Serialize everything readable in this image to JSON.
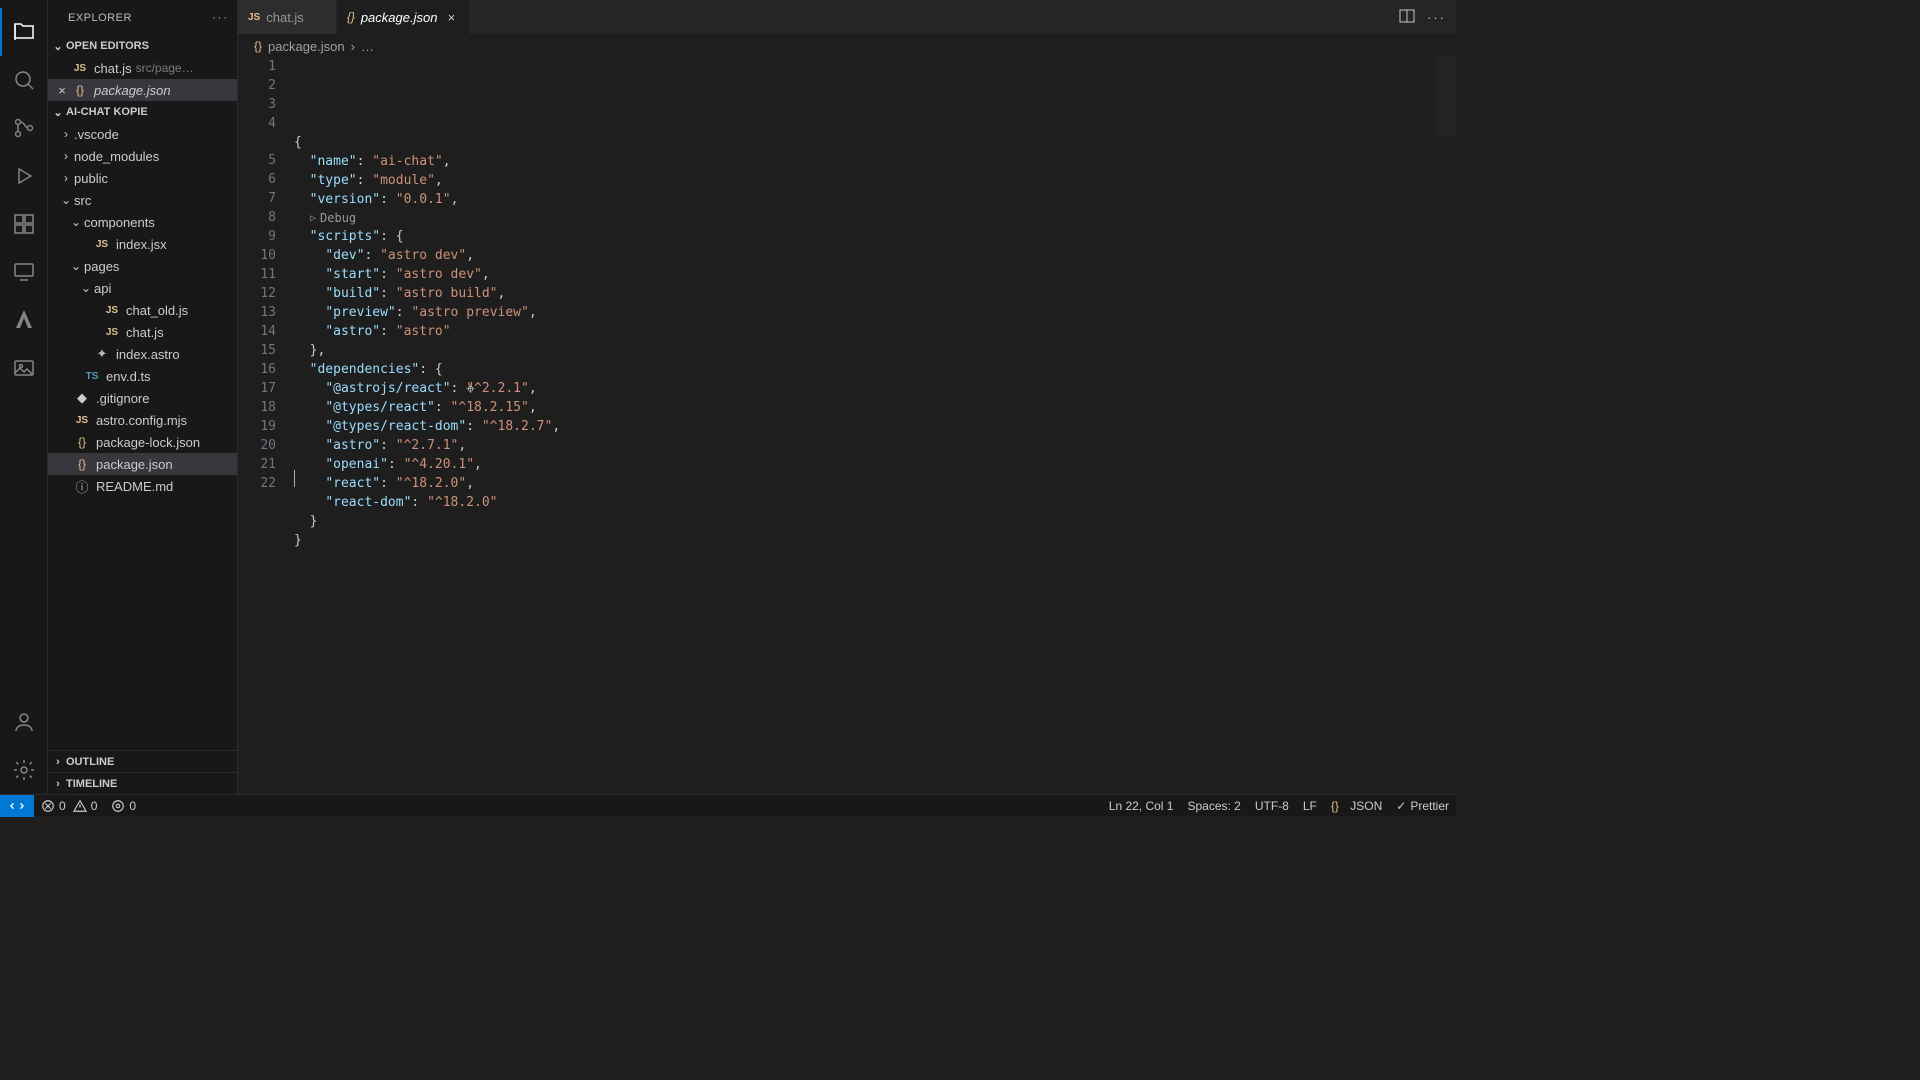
{
  "explorer_title": "EXPLORER",
  "open_editors_label": "OPEN EDITORS",
  "open_editors": [
    {
      "name": "chat.js",
      "hint": "src/page…",
      "icon": "js",
      "modified": false,
      "close_showing": false
    },
    {
      "name": "package.json",
      "hint": "",
      "icon": "json",
      "modified": false,
      "close_showing": true
    }
  ],
  "project_label": "AI-CHAT KOPIE",
  "tree": [
    {
      "depth": 0,
      "chev": "›",
      "icon": "",
      "label": ".vscode"
    },
    {
      "depth": 0,
      "chev": "›",
      "icon": "",
      "label": "node_modules"
    },
    {
      "depth": 0,
      "chev": "›",
      "icon": "",
      "label": "public"
    },
    {
      "depth": 0,
      "chev": "⌄",
      "icon": "",
      "label": "src"
    },
    {
      "depth": 1,
      "chev": "⌄",
      "icon": "",
      "label": "components"
    },
    {
      "depth": 2,
      "chev": "",
      "icon": "js",
      "label": "index.jsx"
    },
    {
      "depth": 1,
      "chev": "⌄",
      "icon": "",
      "label": "pages"
    },
    {
      "depth": 2,
      "chev": "⌄",
      "icon": "",
      "label": "api"
    },
    {
      "depth": 3,
      "chev": "",
      "icon": "js",
      "label": "chat_old.js"
    },
    {
      "depth": 3,
      "chev": "",
      "icon": "js",
      "label": "chat.js"
    },
    {
      "depth": 2,
      "chev": "",
      "icon": "astro",
      "label": "index.astro"
    },
    {
      "depth": 1,
      "chev": "",
      "icon": "ts",
      "label": "env.d.ts"
    },
    {
      "depth": 0,
      "chev": "",
      "icon": "git",
      "label": ".gitignore"
    },
    {
      "depth": 0,
      "chev": "",
      "icon": "js",
      "label": "astro.config.mjs"
    },
    {
      "depth": 0,
      "chev": "",
      "icon": "json",
      "label": "package-lock.json"
    },
    {
      "depth": 0,
      "chev": "",
      "icon": "json",
      "label": "package.json",
      "selected": true
    },
    {
      "depth": 0,
      "chev": "",
      "icon": "info",
      "label": "README.md"
    }
  ],
  "outline_label": "OUTLINE",
  "timeline_label": "TIMELINE",
  "tabs": [
    {
      "icon": "js",
      "label": "chat.js",
      "active": false
    },
    {
      "icon": "json",
      "label": "package.json",
      "active": true
    }
  ],
  "breadcrumbs": {
    "file": "package.json",
    "sep": "›",
    "node": "…"
  },
  "codelens_debug": "Debug",
  "code_lines": [
    {
      "n": 1,
      "tokens": [
        [
          "pun",
          "{"
        ]
      ]
    },
    {
      "n": 2,
      "tokens": [
        [
          "pun",
          "  "
        ],
        [
          "key",
          "\"name\""
        ],
        [
          "pun",
          ": "
        ],
        [
          "str",
          "\"ai-chat\""
        ],
        [
          "pun",
          ","
        ]
      ]
    },
    {
      "n": 3,
      "tokens": [
        [
          "pun",
          "  "
        ],
        [
          "key",
          "\"type\""
        ],
        [
          "pun",
          ": "
        ],
        [
          "str",
          "\"module\""
        ],
        [
          "pun",
          ","
        ]
      ]
    },
    {
      "n": 4,
      "tokens": [
        [
          "pun",
          "  "
        ],
        [
          "key",
          "\"version\""
        ],
        [
          "pun",
          ": "
        ],
        [
          "str",
          "\"0.0.1\""
        ],
        [
          "pun",
          ","
        ]
      ]
    },
    {
      "codelens": true
    },
    {
      "n": 5,
      "tokens": [
        [
          "pun",
          "  "
        ],
        [
          "key",
          "\"scripts\""
        ],
        [
          "pun",
          ": {"
        ]
      ]
    },
    {
      "n": 6,
      "tokens": [
        [
          "pun",
          "    "
        ],
        [
          "key",
          "\"dev\""
        ],
        [
          "pun",
          ": "
        ],
        [
          "str",
          "\"astro dev\""
        ],
        [
          "pun",
          ","
        ]
      ]
    },
    {
      "n": 7,
      "tokens": [
        [
          "pun",
          "    "
        ],
        [
          "key",
          "\"start\""
        ],
        [
          "pun",
          ": "
        ],
        [
          "str",
          "\"astro dev\""
        ],
        [
          "pun",
          ","
        ]
      ]
    },
    {
      "n": 8,
      "tokens": [
        [
          "pun",
          "    "
        ],
        [
          "key",
          "\"build\""
        ],
        [
          "pun",
          ": "
        ],
        [
          "str",
          "\"astro build\""
        ],
        [
          "pun",
          ","
        ]
      ]
    },
    {
      "n": 9,
      "tokens": [
        [
          "pun",
          "    "
        ],
        [
          "key",
          "\"preview\""
        ],
        [
          "pun",
          ": "
        ],
        [
          "str",
          "\"astro preview\""
        ],
        [
          "pun",
          ","
        ]
      ]
    },
    {
      "n": 10,
      "tokens": [
        [
          "pun",
          "    "
        ],
        [
          "key",
          "\"astro\""
        ],
        [
          "pun",
          ": "
        ],
        [
          "str",
          "\"astro\""
        ]
      ]
    },
    {
      "n": 11,
      "tokens": [
        [
          "pun",
          "  },"
        ]
      ]
    },
    {
      "n": 12,
      "tokens": [
        [
          "pun",
          "  "
        ],
        [
          "key",
          "\"dependencies\""
        ],
        [
          "pun",
          ": {"
        ]
      ]
    },
    {
      "n": 13,
      "tokens": [
        [
          "pun",
          "    "
        ],
        [
          "key",
          "\"@astrojs/react\""
        ],
        [
          "pun",
          ": "
        ],
        [
          "str",
          "\"^2.2.1\""
        ],
        [
          "pun",
          ","
        ]
      ]
    },
    {
      "n": 14,
      "tokens": [
        [
          "pun",
          "    "
        ],
        [
          "key",
          "\"@types/react\""
        ],
        [
          "pun",
          ": "
        ],
        [
          "str",
          "\"^18.2.15\""
        ],
        [
          "pun",
          ","
        ]
      ]
    },
    {
      "n": 15,
      "tokens": [
        [
          "pun",
          "    "
        ],
        [
          "key",
          "\"@types/react-dom\""
        ],
        [
          "pun",
          ": "
        ],
        [
          "str",
          "\"^18.2.7\""
        ],
        [
          "pun",
          ","
        ]
      ]
    },
    {
      "n": 16,
      "tokens": [
        [
          "pun",
          "    "
        ],
        [
          "key",
          "\"astro\""
        ],
        [
          "pun",
          ": "
        ],
        [
          "str",
          "\"^2.7.1\""
        ],
        [
          "pun",
          ","
        ]
      ]
    },
    {
      "n": 17,
      "tokens": [
        [
          "pun",
          "    "
        ],
        [
          "key",
          "\"openai\""
        ],
        [
          "pun",
          ": "
        ],
        [
          "str",
          "\"^4.20.1\""
        ],
        [
          "pun",
          ","
        ]
      ]
    },
    {
      "n": 18,
      "tokens": [
        [
          "pun",
          "    "
        ],
        [
          "key",
          "\"react\""
        ],
        [
          "pun",
          ": "
        ],
        [
          "str",
          "\"^18.2.0\""
        ],
        [
          "pun",
          ","
        ]
      ]
    },
    {
      "n": 19,
      "tokens": [
        [
          "pun",
          "    "
        ],
        [
          "key",
          "\"react-dom\""
        ],
        [
          "pun",
          ": "
        ],
        [
          "str",
          "\"^18.2.0\""
        ]
      ]
    },
    {
      "n": 20,
      "tokens": [
        [
          "pun",
          "  }"
        ]
      ]
    },
    {
      "n": 21,
      "tokens": [
        [
          "pun",
          "}"
        ]
      ]
    },
    {
      "n": 22,
      "tokens": [
        [
          "pun",
          ""
        ]
      ]
    }
  ],
  "statusbar": {
    "errors": "0",
    "warnings": "0",
    "ports": "0",
    "cursor": "Ln 22, Col 1",
    "spaces": "Spaces: 2",
    "encoding": "UTF-8",
    "eol": "LF",
    "lang": "JSON",
    "formatter": "Prettier"
  }
}
